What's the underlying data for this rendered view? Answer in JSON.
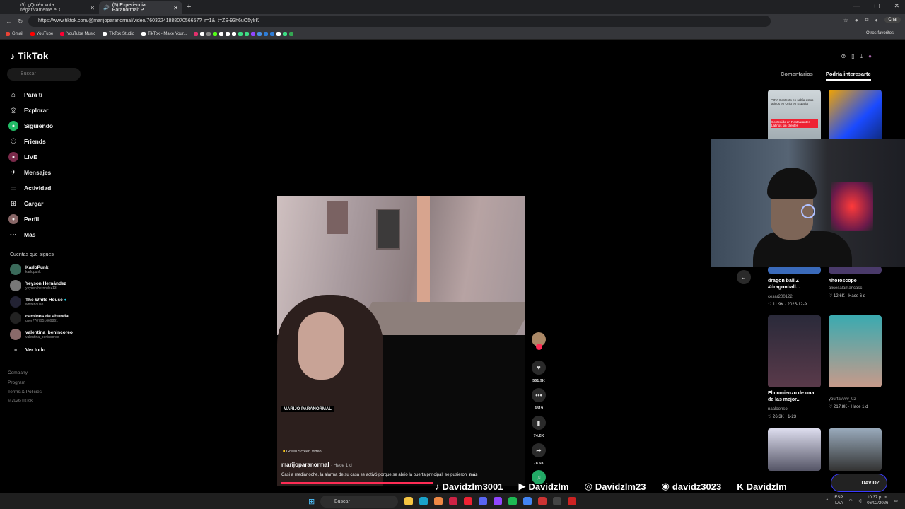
{
  "browser": {
    "tabs": [
      {
        "label": "(5) ¿Quién vota negativamente el C",
        "active": false
      },
      {
        "label": "(5) Experiencia Paranormal: P",
        "active": true
      }
    ],
    "url": "https://www.tiktok.com/@marijoparanormal/video/7603224188807056657?_r=1&_t=ZS-93h6uO5ylrK",
    "chat_label": "Chat",
    "bookmarks": [
      "Gmail",
      "YouTube",
      "YouTube Music",
      "TikTok Studio",
      "TikTok - Make Your..."
    ],
    "other_bookmarks": "Otros favoritos"
  },
  "sidebar": {
    "logo": "TikTok",
    "search_placeholder": "Buscar",
    "nav": [
      {
        "label": "Para ti",
        "icon": "home-icon"
      },
      {
        "label": "Explorar",
        "icon": "compass-icon"
      },
      {
        "label": "Siguiendo",
        "icon": "following-icon"
      },
      {
        "label": "Friends",
        "icon": "friends-icon"
      },
      {
        "label": "LIVE",
        "icon": "live-icon"
      },
      {
        "label": "Mensajes",
        "icon": "messages-icon"
      },
      {
        "label": "Actividad",
        "icon": "activity-icon"
      },
      {
        "label": "Cargar",
        "icon": "upload-icon"
      },
      {
        "label": "Perfil",
        "icon": "profile-icon"
      },
      {
        "label": "Más",
        "icon": "more-icon"
      }
    ],
    "following_title": "Cuentas que sigues",
    "following": [
      {
        "name": "KarloPunk",
        "handle": "karlopunk"
      },
      {
        "name": "Yeyson Hernández",
        "handle": "yeyson.hernndez13"
      },
      {
        "name": "The White House",
        "handle": "whitehouse"
      },
      {
        "name": "caminos de abunda...",
        "handle": "user7707951669861"
      },
      {
        "name": "valentina_benincoreo",
        "handle": "valentina_benincoree"
      }
    ],
    "see_all": "Ver todo",
    "footer": [
      "Company",
      "Program",
      "Terms & Policies",
      "© 2026 TikTok"
    ]
  },
  "video": {
    "overlay_tag": "MARIJO PARANORMAL",
    "green_screen": "Green Screen Video",
    "author": "marijoparanormal",
    "posted": "· Hace 1 d",
    "description": "Casi a medianoche, la alarma de su casa se activó porque se abrió la puerta principal, se pusieron",
    "more": "más",
    "likes": "561.9K",
    "comments": "4819",
    "saves": "74.2K",
    "shares": "78.6K"
  },
  "right_panel": {
    "tabs": [
      "Comentarios",
      "Podría interesarte"
    ],
    "thumb1_caption": "POV: Contexto en sabía estos latinos en Ohio en España",
    "thumb1_sticker": "Contenido en Restaurantes Latinos sin clientes",
    "cards": [
      {
        "title": "dragon ball Z #dragonball...",
        "user": "cesar200122",
        "likes": "11.9K",
        "date": "2025-12-9"
      },
      {
        "title": "#horoscope",
        "user": "alicesalamancasc",
        "likes": "12.6K",
        "date": "Hace 6 d"
      },
      {
        "title": "El comienzo de una de las mejor...",
        "user": "naaloonso",
        "likes": "26.3K",
        "date": "1-23"
      },
      {
        "title": "",
        "user": "yourfavvvv_02",
        "likes": "217.8K",
        "date": "Hace 1 d"
      }
    ]
  },
  "social": [
    {
      "platform": "TikTok",
      "handle": "Davidzlm3001",
      "sym": "♪"
    },
    {
      "platform": "YouTube",
      "handle": "Davidzlm",
      "sym": "▶"
    },
    {
      "platform": "Instagram",
      "handle": "Davidzlm23",
      "sym": "◎"
    },
    {
      "platform": "Discord",
      "handle": "davidz3023",
      "sym": "◉"
    },
    {
      "platform": "Kick",
      "handle": "Davidzlm",
      "sym": "K"
    }
  ],
  "stream_badge": "DAVIDZ",
  "taskbar": {
    "search": "Buscar",
    "lang1": "ESP",
    "lang2": "LAA",
    "time": "10:37 p. m.",
    "date": "06/02/2026"
  }
}
